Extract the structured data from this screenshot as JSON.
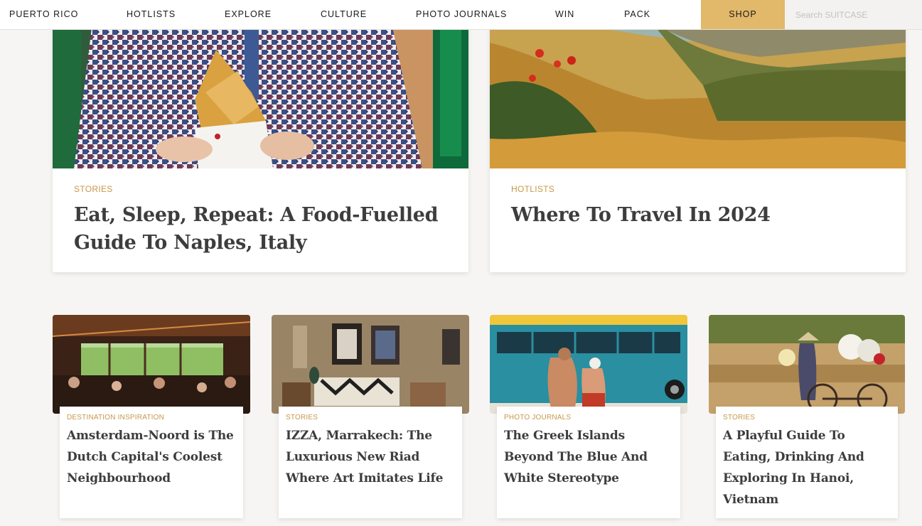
{
  "nav": {
    "items": [
      "PUERTO RICO",
      "HOTLISTS",
      "EXPLORE",
      "CULTURE",
      "PHOTO JOURNALS",
      "WIN",
      "PACK"
    ],
    "shop_label": "SHOP",
    "search_placeholder": "Search SUITCASE",
    "shop_color": "#e2b86a"
  },
  "featured": [
    {
      "category": "STORIES",
      "title": "Eat, Sleep, Repeat: A Food-Fuelled Guide To Naples, Italy"
    },
    {
      "category": "HOTLISTS",
      "title": "Where To Travel In 2024"
    }
  ],
  "articles": [
    {
      "category": "DESTINATION INSPIRATION",
      "title": "Amsterdam-Noord is The Dutch Capital's Coolest Neighbourhood"
    },
    {
      "category": "STORIES",
      "title": "IZZA, Marrakech: The Luxurious New Riad Where Art Imitates Life"
    },
    {
      "category": "PHOTO JOURNALS",
      "title": "The Greek Islands Beyond The Blue And White Stereotype"
    },
    {
      "category": "STORIES",
      "title": "A Playful Guide To Eating, Drinking And Exploring In Hanoi, Vietnam"
    }
  ],
  "colors": {
    "category": "#c8974a",
    "title": "#3d3d3d",
    "background": "#f6f5f3"
  }
}
